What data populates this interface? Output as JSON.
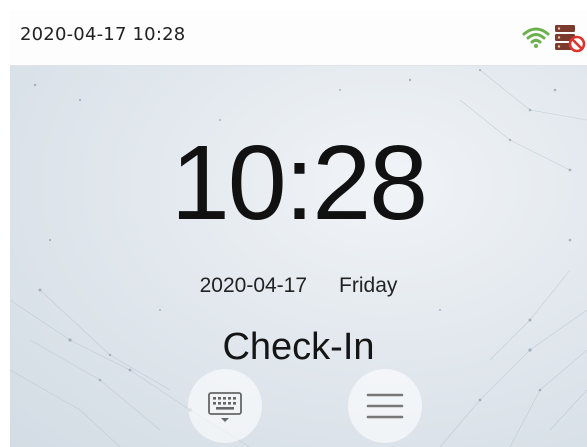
{
  "status_bar": {
    "datetime": "2020-04-17 10:28",
    "icons": [
      "wifi-icon",
      "server-disconnected-icon"
    ]
  },
  "main": {
    "time": "10:28",
    "date": "2020-04-17",
    "weekday": "Friday",
    "state": "Check-In"
  },
  "buttons": {
    "left_icon": "keyboard-icon",
    "right_icon": "menu-icon"
  },
  "colors": {
    "wifi": "#6ab04c",
    "server": "#7a3b2e",
    "alert": "#e0322b"
  }
}
